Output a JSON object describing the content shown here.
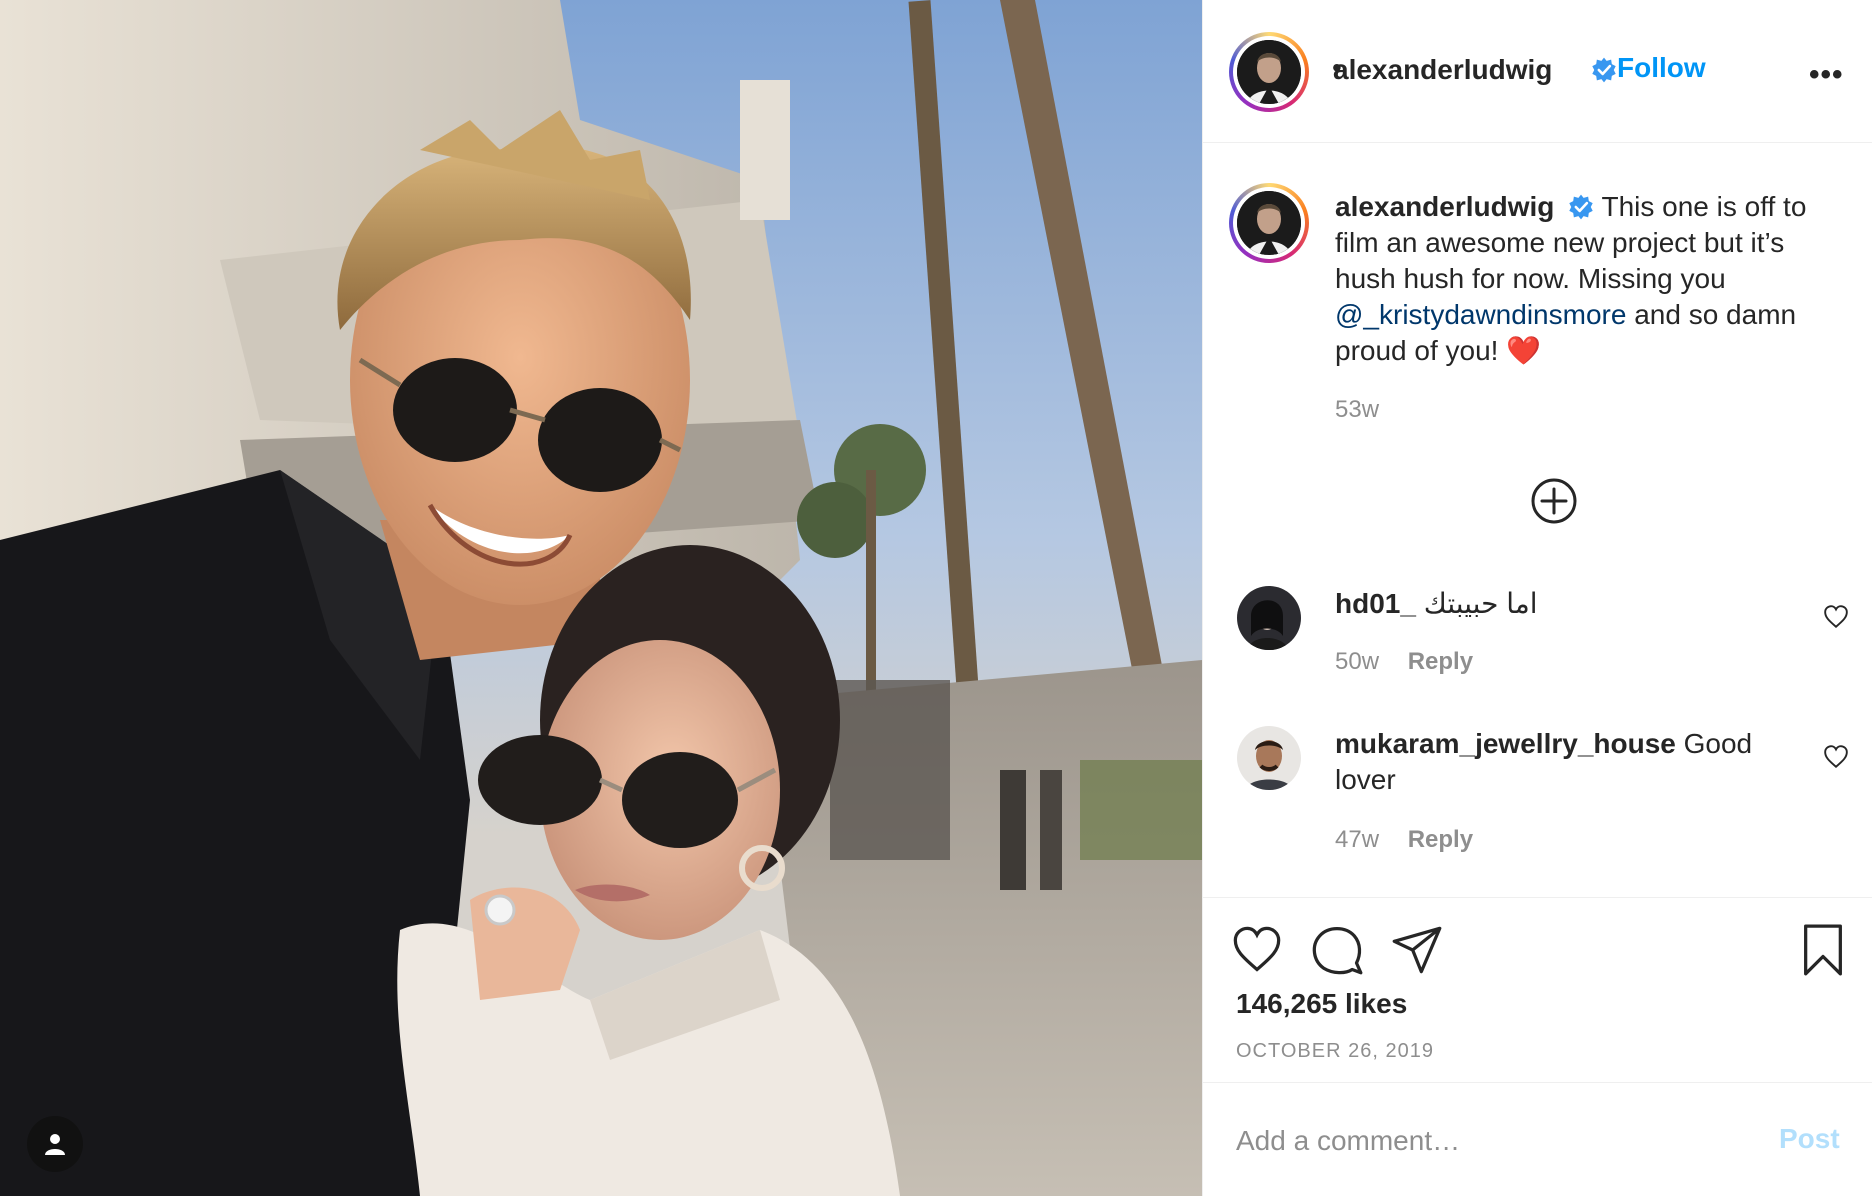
{
  "post": {
    "username": "alexanderludwig",
    "separator": "•",
    "follow_label": "Follow",
    "more_label": "•••",
    "caption_text": "This one is off to film an awesome new project but it’s hush hush for now. Missing you",
    "caption_mention": "@_kristydawndinsmore",
    "caption_tail": "and so damn proud of you!",
    "caption_emoji": "❤️",
    "caption_time": "53w",
    "likes": "146,265 likes",
    "date": "OCTOBER 26, 2019"
  },
  "comments": [
    {
      "username": "hd01_",
      "text": "اما حبيبتك",
      "time": "50w",
      "reply_label": "Reply"
    },
    {
      "username": "mukaram_jewellry_house",
      "text": "Good lover",
      "time": "47w",
      "reply_label": "Reply"
    }
  ],
  "add_comment": {
    "placeholder": "Add a comment…",
    "post_label": "Post"
  },
  "icons": {
    "verified": "verified-badge-icon",
    "load_more": "plus-circle-icon",
    "like": "heart-icon",
    "comment": "comment-bubble-icon",
    "share": "paper-plane-icon",
    "save": "bookmark-icon",
    "user_tag": "user-icon"
  },
  "colors": {
    "link": "#0095f6",
    "mention": "#00376b",
    "muted": "#8e8e8e",
    "post_disabled": "#b2dffc"
  }
}
